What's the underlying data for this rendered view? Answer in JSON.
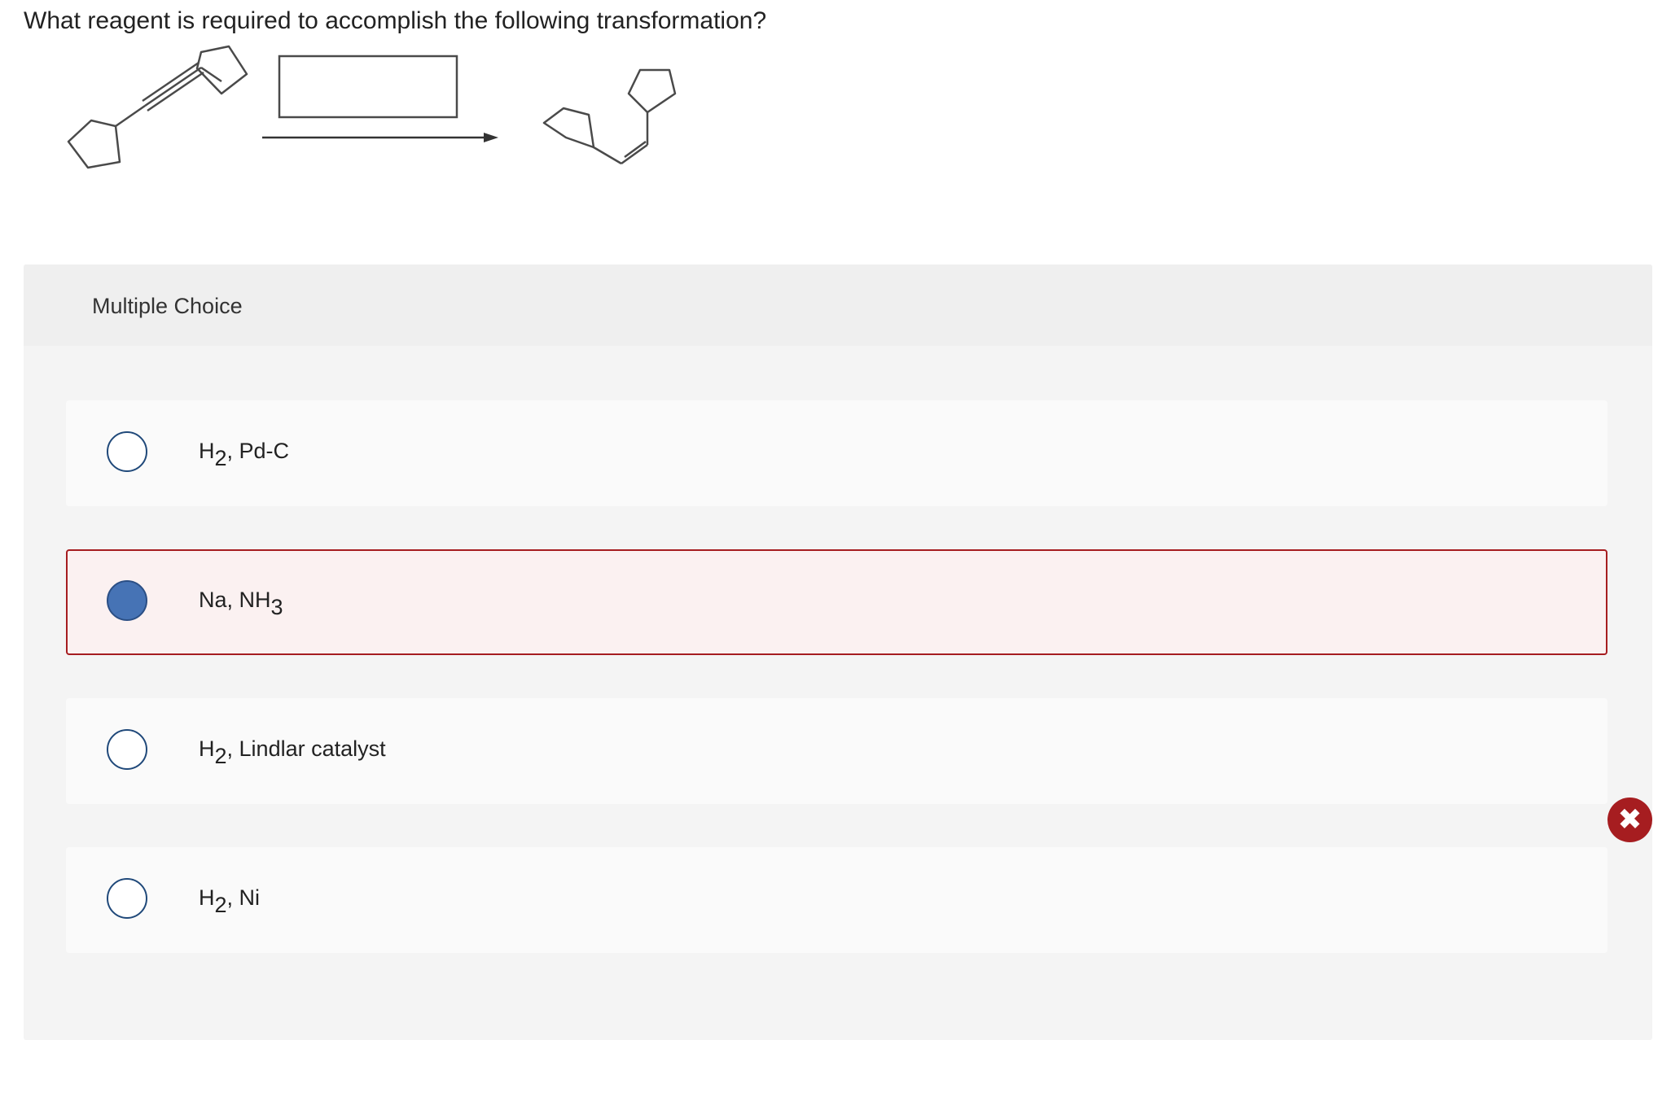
{
  "question": {
    "text": "What reagent is required to accomplish the following transformation?"
  },
  "reaction": {
    "reagent_box_value": "",
    "reactant_icon": "cyclopentyl-alkyne-structure",
    "product_icon": "cis-alkene-structure"
  },
  "multiple_choice": {
    "header_label": "Multiple Choice",
    "options": [
      {
        "main": "H",
        "sub": "2",
        "rest": ", Pd-C",
        "selected": false,
        "status": ""
      },
      {
        "main": "Na, NH",
        "sub": "3",
        "rest": "",
        "selected": true,
        "status": "incorrect"
      },
      {
        "main": "H",
        "sub": "2",
        "rest": ", Lindlar catalyst",
        "selected": false,
        "status": ""
      },
      {
        "main": "H",
        "sub": "2",
        "rest": ", Ni",
        "selected": false,
        "status": ""
      }
    ]
  },
  "feedback": {
    "icon": "incorrect-x-icon",
    "color": "#a61d20"
  },
  "colors": {
    "selected_radio": "#4673b5",
    "incorrect_border": "#a61d20",
    "radio_border": "#20497a"
  }
}
